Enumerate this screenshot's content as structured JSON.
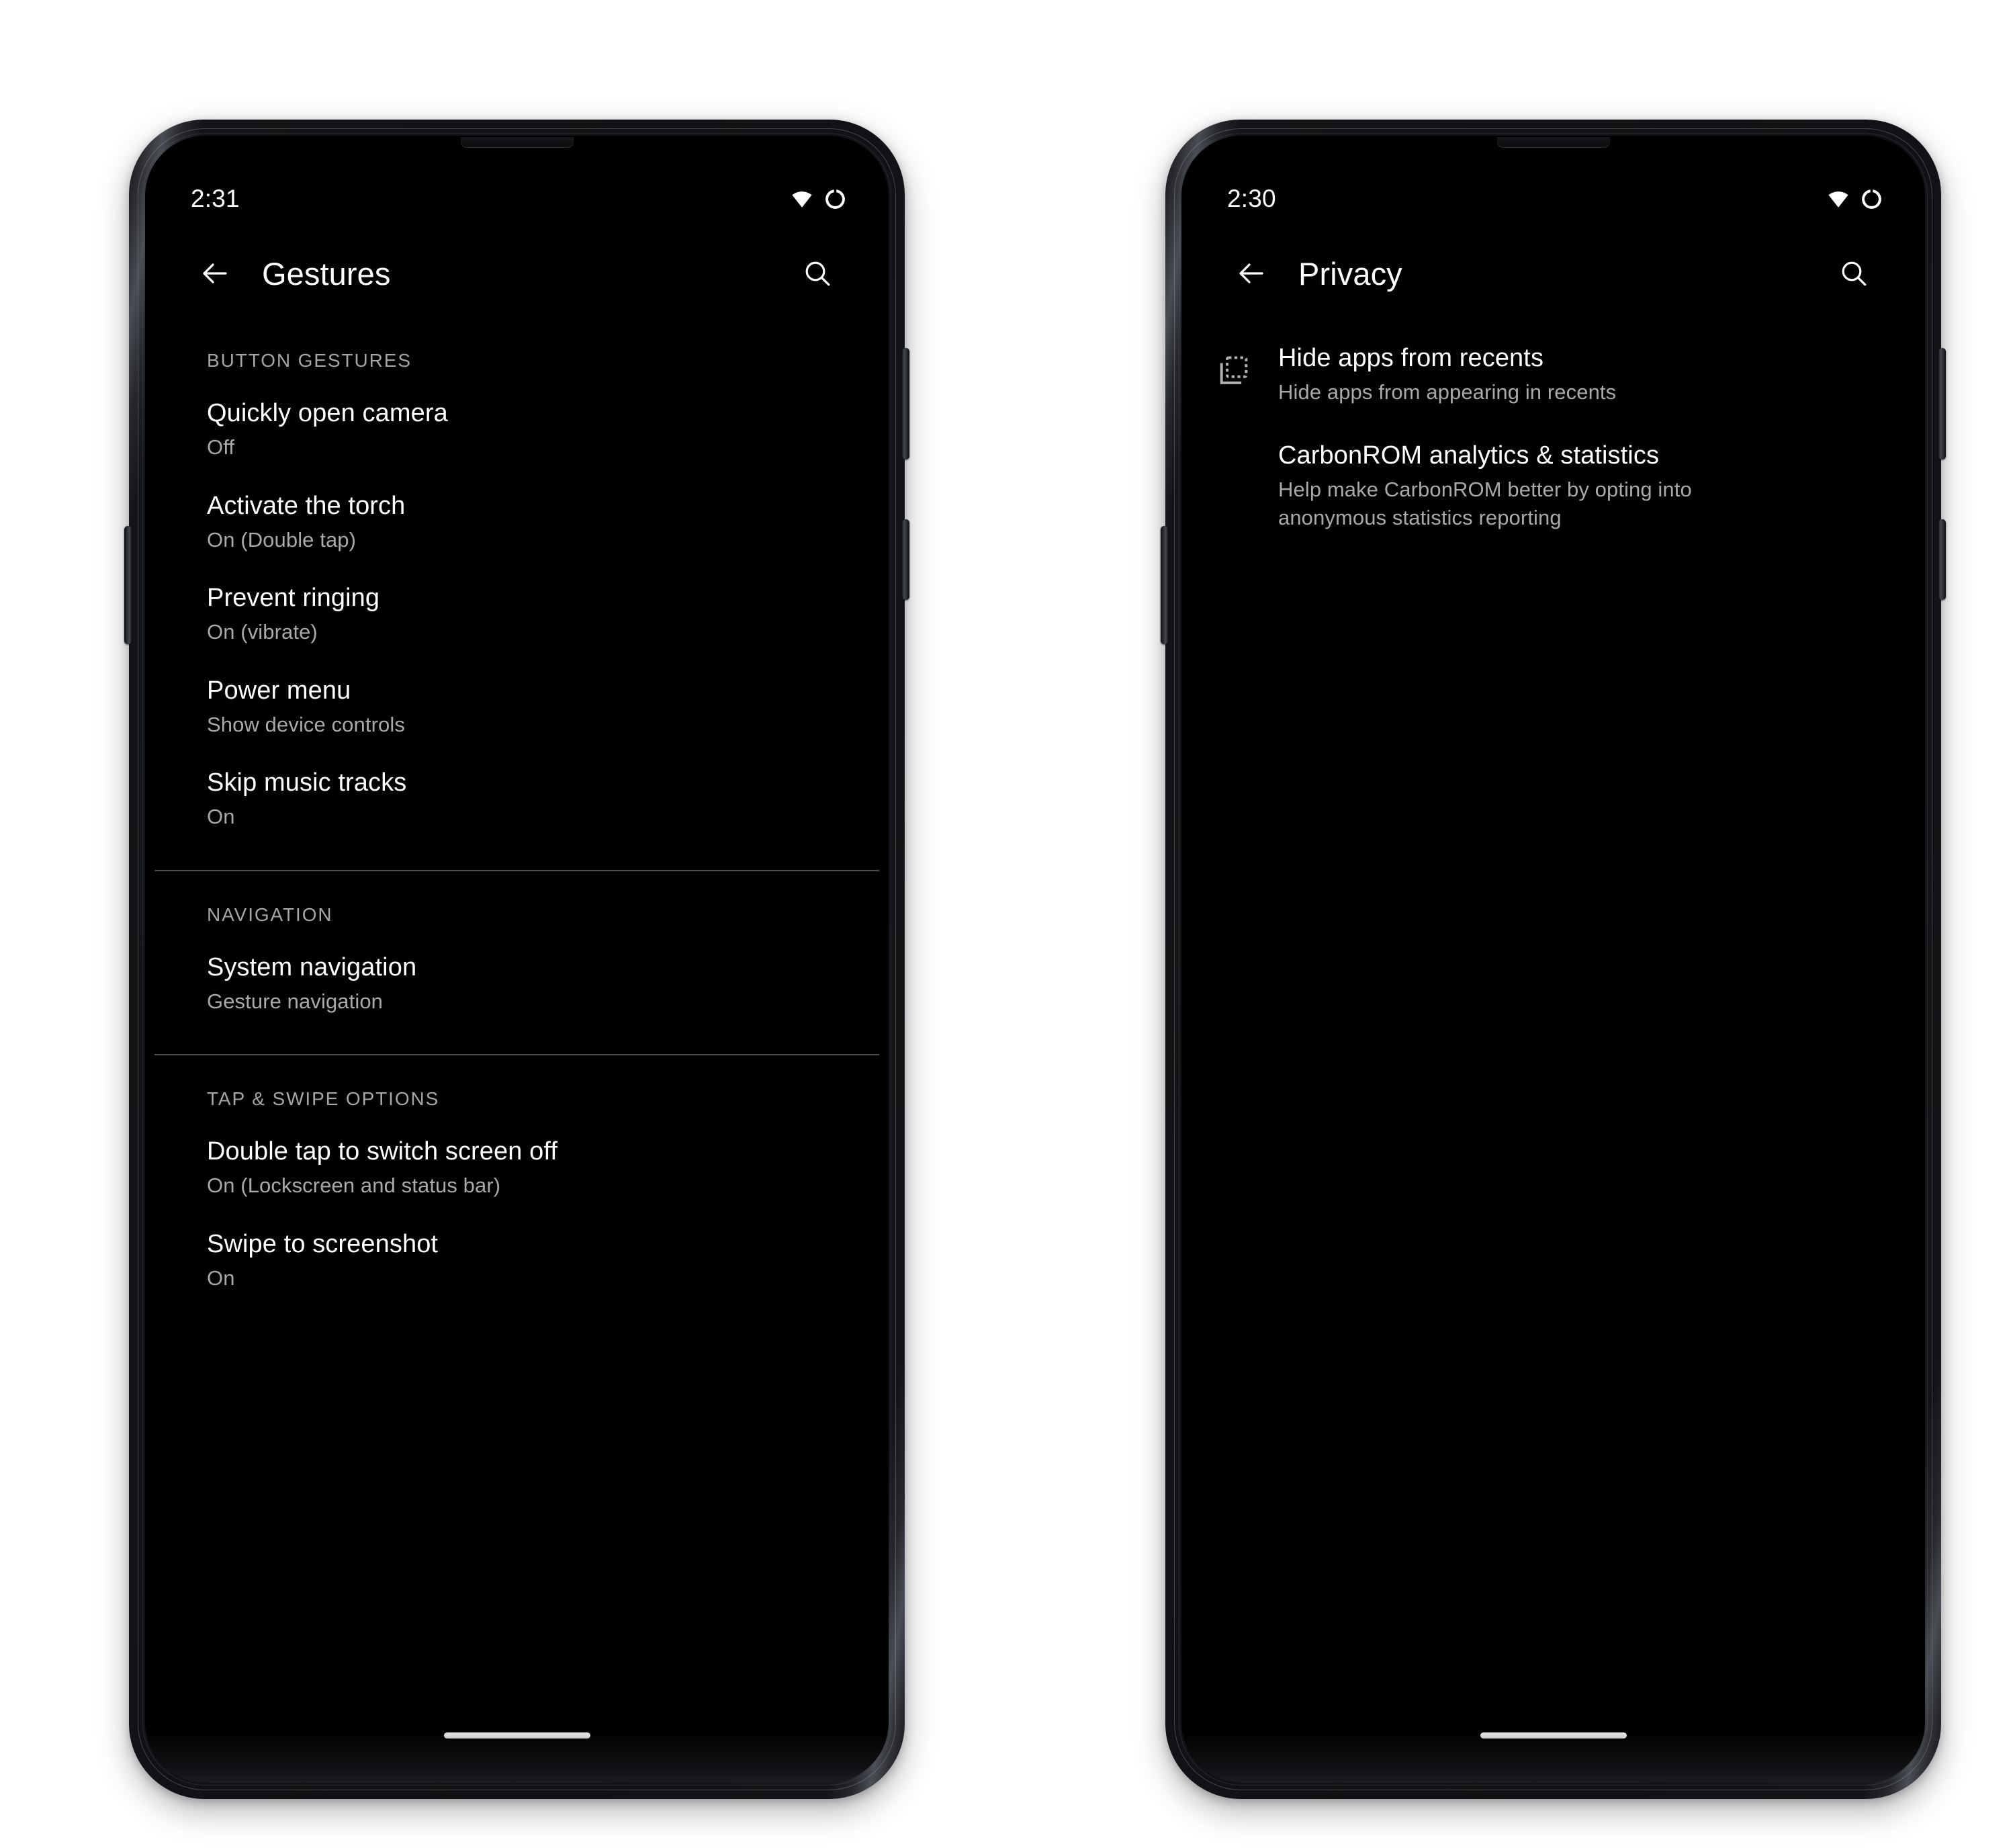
{
  "phones": [
    {
      "id": "gestures",
      "status": {
        "time": "2:31",
        "wifi_icon": "wifi-icon",
        "battery_icon": "battery-circle-icon"
      },
      "appbar": {
        "back_icon": "back-arrow-icon",
        "title": "Gestures",
        "search_icon": "search-icon"
      },
      "groups": [
        {
          "header": "BUTTON GESTURES",
          "divider_after": true,
          "items": [
            {
              "title": "Quickly open camera",
              "summary": "Off"
            },
            {
              "title": "Activate the torch",
              "summary": "On (Double tap)"
            },
            {
              "title": "Prevent ringing",
              "summary": "On (vibrate)"
            },
            {
              "title": "Power menu",
              "summary": "Show device controls"
            },
            {
              "title": "Skip music tracks",
              "summary": "On"
            }
          ]
        },
        {
          "header": "NAVIGATION",
          "divider_after": true,
          "items": [
            {
              "title": "System navigation",
              "summary": "Gesture navigation"
            }
          ]
        },
        {
          "header": "TAP & SWIPE OPTIONS",
          "divider_after": false,
          "items": [
            {
              "title": "Double tap to switch screen off",
              "summary": "On (Lockscreen and status bar)"
            },
            {
              "title": "Swipe to screenshot",
              "summary": "On"
            }
          ]
        }
      ],
      "nav_pill": "gesture-nav-pill"
    },
    {
      "id": "privacy",
      "status": {
        "time": "2:30",
        "wifi_icon": "wifi-icon",
        "battery_icon": "battery-circle-icon"
      },
      "appbar": {
        "back_icon": "back-arrow-icon",
        "title": "Privacy",
        "search_icon": "search-icon"
      },
      "groups": [
        {
          "header": "",
          "divider_after": false,
          "items": [
            {
              "title": "Hide apps from recents",
              "summary": "Hide apps from appearing in recents",
              "icon": "hide-from-recents-icon"
            },
            {
              "title": "CarbonROM analytics & statistics",
              "summary": "Help make CarbonROM better by opting into anonymous statistics reporting",
              "icon": ""
            }
          ]
        }
      ],
      "nav_pill": "gesture-nav-pill"
    }
  ],
  "colors": {
    "screen_background": "#000000",
    "primary_text": "#ffffff",
    "secondary_text": "#a9a9a9",
    "group_header_text": "#a6a6a6",
    "divider": "#4b4d50",
    "page_background": "#ffffff"
  }
}
